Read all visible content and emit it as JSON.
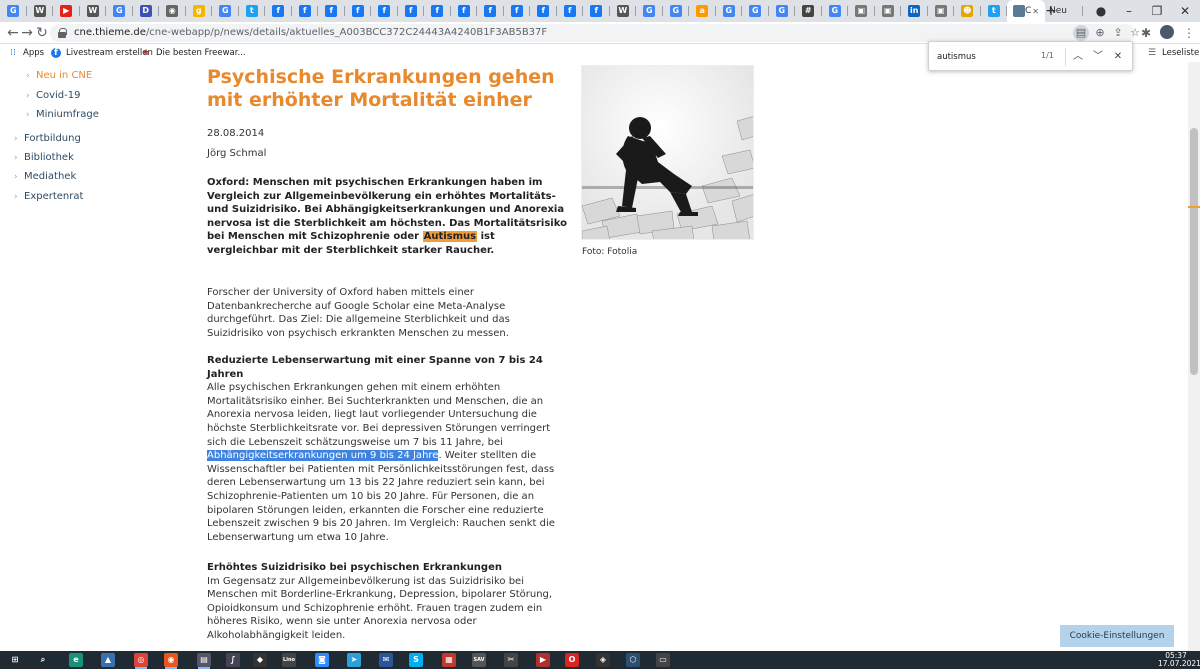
{
  "browser": {
    "tabs": [
      {
        "icon": "google-icon",
        "glyph": "G",
        "color": "#4285f4"
      },
      {
        "icon": "wikipedia-icon",
        "glyph": "W",
        "color": "#555"
      },
      {
        "icon": "youtube-icon",
        "glyph": "▶",
        "color": "#e62117"
      },
      {
        "icon": "wikipedia-icon",
        "glyph": "W",
        "color": "#555"
      },
      {
        "icon": "google-icon",
        "glyph": "G",
        "color": "#4285f4"
      },
      {
        "icon": "bookmark-d-icon",
        "glyph": "D",
        "color": "#3f51b5"
      },
      {
        "icon": "globe-icon",
        "glyph": "◉",
        "color": "#666"
      },
      {
        "icon": "g-icon",
        "glyph": "g",
        "color": "#f4b400"
      },
      {
        "icon": "google-icon",
        "glyph": "G",
        "color": "#4285f4"
      },
      {
        "icon": "twitter-icon",
        "glyph": "t",
        "color": "#1da1f2"
      },
      {
        "icon": "facebook-icon",
        "glyph": "f",
        "color": "#1877f2"
      },
      {
        "icon": "facebook-icon",
        "glyph": "f",
        "color": "#1877f2"
      },
      {
        "icon": "facebook-icon",
        "glyph": "f",
        "color": "#1877f2"
      },
      {
        "icon": "facebook-icon",
        "glyph": "f",
        "color": "#1877f2"
      },
      {
        "icon": "facebook-icon",
        "glyph": "f",
        "color": "#1877f2"
      },
      {
        "icon": "facebook-icon",
        "glyph": "f",
        "color": "#1877f2"
      },
      {
        "icon": "facebook-icon",
        "glyph": "f",
        "color": "#1877f2"
      },
      {
        "icon": "facebook-icon",
        "glyph": "f",
        "color": "#1877f2"
      },
      {
        "icon": "facebook-icon",
        "glyph": "f",
        "color": "#1877f2"
      },
      {
        "icon": "facebook-icon",
        "glyph": "f",
        "color": "#1877f2"
      },
      {
        "icon": "facebook-icon",
        "glyph": "f",
        "color": "#1877f2"
      },
      {
        "icon": "facebook-icon",
        "glyph": "f",
        "color": "#1877f2"
      },
      {
        "icon": "facebook-icon",
        "glyph": "f",
        "color": "#1877f2"
      },
      {
        "icon": "wikipedia-icon",
        "glyph": "W",
        "color": "#555"
      },
      {
        "icon": "google-icon",
        "glyph": "G",
        "color": "#4285f4"
      },
      {
        "icon": "google-icon",
        "glyph": "G",
        "color": "#4285f4"
      },
      {
        "icon": "amazon-icon",
        "glyph": "a",
        "color": "#ff9900"
      },
      {
        "icon": "google-icon",
        "glyph": "G",
        "color": "#4285f4"
      },
      {
        "icon": "google-icon",
        "glyph": "G",
        "color": "#4285f4"
      },
      {
        "icon": "google-icon",
        "glyph": "G",
        "color": "#4285f4"
      },
      {
        "icon": "grid-icon",
        "glyph": "#",
        "color": "#444"
      },
      {
        "icon": "google-icon",
        "glyph": "G",
        "color": "#4285f4"
      },
      {
        "icon": "image-icon",
        "glyph": "▣",
        "color": "#777"
      },
      {
        "icon": "image-icon",
        "glyph": "▣",
        "color": "#777"
      },
      {
        "icon": "linkedin-icon",
        "glyph": "in",
        "color": "#0a66c2"
      },
      {
        "icon": "image-icon",
        "glyph": "▣",
        "color": "#777"
      },
      {
        "icon": "emoji-icon",
        "glyph": "☻",
        "color": "#e0a800"
      },
      {
        "icon": "twitter-icon",
        "glyph": "t",
        "color": "#1da1f2"
      }
    ],
    "active_tab_label": "C",
    "neu_tab_label": "Neu",
    "url_host": "cne.thieme.de",
    "url_path": "/cne-webapp/p/news/details/aktuelles_A003BCC372C24443A4240B1F3AB5B37F",
    "bookmarks": [
      {
        "label": "Apps",
        "icon": "apps-grid-icon"
      },
      {
        "label": "Livestream erstellen",
        "icon": "facebook-icon"
      },
      {
        "label": "Die besten Freewar...",
        "icon": "star-icon"
      }
    ],
    "reading_list_label": "Leseliste"
  },
  "find": {
    "query": "autismus",
    "count": "1/1"
  },
  "sidebar": {
    "items": [
      {
        "label": "Neu in CNE",
        "level": 2,
        "active": true
      },
      {
        "label": "Covid-19",
        "level": 2,
        "active": false
      },
      {
        "label": "Miniumfrage",
        "level": 2,
        "active": false
      },
      {
        "label": "Fortbildung",
        "level": 1,
        "active": false
      },
      {
        "label": "Bibliothek",
        "level": 1,
        "active": false
      },
      {
        "label": "Mediathek",
        "level": 1,
        "active": false
      },
      {
        "label": "Expertenrat",
        "level": 1,
        "active": false
      }
    ]
  },
  "article": {
    "title": "Psychische Erkrankungen gehen mit erhöhter Mortalität einher",
    "date": "28.08.2014",
    "author": "Jörg Schmal",
    "lead_before": "Oxford: Menschen mit psychischen Erkrankungen haben im Vergleich zur Allgemeinbevölkerung ein erhöhtes Mortalitäts- und Suizidrisiko. Bei Abhängigkeitserkrankungen und Anorexia nervosa ist die Sterblichkeit am höchsten. Das Mortalitätsrisiko bei Menschen mit Schizophrenie oder ",
    "lead_match": "Autismus",
    "lead_after": " ist vergleichbar mit der Sterblichkeit starker Raucher.",
    "p1": "Forscher der University of Oxford haben mittels einer Datenbankrecherche auf Google Scholar eine Meta-Analyse durchgeführt. Das Ziel: Die allgemeine Sterblichkeit und das Suizidrisiko von psychisch erkrankten Menschen zu messen.",
    "h2": "Reduzierte Lebenserwartung mit einer Spanne von 7 bis 24 Jahren",
    "p2_before": "Alle psychischen Erkrankungen gehen mit einem erhöhten Mortalitätsrisiko einher. Bei Suchterkrankten und Menschen, die an Anorexia nervosa leiden, liegt laut vorliegender Untersuchung die höchste Sterblichkeitsrate vor. Bei depressiven Störungen verringert sich die Lebenszeit schätzungsweise um 7 bis 11 Jahre, bei ",
    "p2_selected": "Abhängigkeitserkrankungen um 9 bis 24 Jahre",
    "p2_after": ". Weiter stellten die Wissenschaftler bei Patienten mit Persönlichkeitsstörungen fest, dass deren Lebenserwartung um 13 bis 22 Jahre reduziert sein kann, bei Schizophrenie-Patienten um 10 bis 20 Jahre. Für Personen, die an bipolaren Störungen leiden, erkannten die Forscher eine reduzierte Lebenszeit zwischen 9 bis 20 Jahren. Im Vergleich: Rauchen senkt die Lebenserwartung um etwa 10 Jahre.",
    "h3": "Erhöhtes Suizidrisiko bei psychischen Erkrankungen",
    "p3": "Im Gegensatz zur Allgemeinbevölkerung ist das Suizidrisiko bei Menschen mit Borderline-Erkrankung, Depression, bipolarer Störung, Opioidkonsum und Schizophrenie erhöht. Frauen tragen zudem ein höheres Risiko, wenn sie unter Anorexia nervosa oder Alkoholabhängigkeit leiden.",
    "photo_caption": "Foto: Fotolia"
  },
  "cookie_button": "Cookie-Einstellungen",
  "taskbar": {
    "time": "05:37",
    "date": "17.07.2021",
    "apps": [
      {
        "icon": "windows-start-icon",
        "glyph": "⊞",
        "color": "#1f2a33"
      },
      {
        "icon": "search-icon",
        "glyph": "⌕",
        "color": "#1f2a33"
      },
      {
        "icon": "edge-icon",
        "glyph": "e",
        "color": "#1a8f7a"
      },
      {
        "icon": "image-viewer-icon",
        "glyph": "▲",
        "color": "#3a6fb0"
      },
      {
        "icon": "chrome-icon",
        "glyph": "◎",
        "color": "#db4437"
      },
      {
        "icon": "ubuntu-icon",
        "glyph": "◉",
        "color": "#e95420"
      },
      {
        "icon": "app-icon",
        "glyph": "▤",
        "color": "#556"
      },
      {
        "icon": "script-icon",
        "glyph": "∫",
        "color": "#445"
      },
      {
        "icon": "inkscape-icon",
        "glyph": "◆",
        "color": "#333"
      },
      {
        "icon": "lino-icon",
        "glyph": "Lino",
        "color": "#444"
      },
      {
        "icon": "zoom-icon",
        "glyph": "◙",
        "color": "#2d8cff"
      },
      {
        "icon": "telegram-icon",
        "glyph": "➤",
        "color": "#2aa1da"
      },
      {
        "icon": "mail-icon",
        "glyph": "✉",
        "color": "#2b579a"
      },
      {
        "icon": "skype-icon",
        "glyph": "S",
        "color": "#00aff0"
      },
      {
        "icon": "calculator-icon",
        "glyph": "▦",
        "color": "#c0392b"
      },
      {
        "icon": "card-icon",
        "glyph": "SAV",
        "color": "#555"
      },
      {
        "icon": "tool-icon",
        "glyph": "✂",
        "color": "#444"
      },
      {
        "icon": "media-icon",
        "glyph": "▶",
        "color": "#b03030"
      },
      {
        "icon": "opera-icon",
        "glyph": "O",
        "color": "#d22"
      },
      {
        "icon": "gem-icon",
        "glyph": "◈",
        "color": "#333"
      },
      {
        "icon": "box-icon",
        "glyph": "⬡",
        "color": "#2f4f6f"
      },
      {
        "icon": "terminal-icon",
        "glyph": "▭",
        "color": "#444"
      }
    ]
  }
}
